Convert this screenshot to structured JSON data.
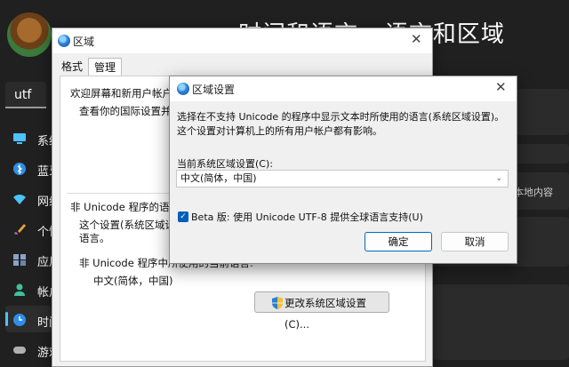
{
  "settings": {
    "search_value": "utf",
    "header_title": "时间和语言 › 语言和区域",
    "side_text": "本地内容",
    "nav": [
      {
        "label": "系统",
        "icon": "monitor-icon"
      },
      {
        "label": "蓝牙和其他设备",
        "icon": "bluetooth-icon"
      },
      {
        "label": "网络和 Internet",
        "icon": "wifi-icon"
      },
      {
        "label": "个性化",
        "icon": "brush-icon"
      },
      {
        "label": "应用",
        "icon": "apps-icon"
      },
      {
        "label": "帐户",
        "icon": "account-icon"
      },
      {
        "label": "时间和语言",
        "icon": "clock-globe-icon"
      },
      {
        "label": "游戏",
        "icon": "gamepad-icon"
      }
    ],
    "accent": "#4cc2ff"
  },
  "region_dialog": {
    "title": "区域",
    "tabs": [
      {
        "label": "格式"
      },
      {
        "label": "管理"
      }
    ],
    "welcome_heading": "欢迎屏幕和新用户帐户",
    "welcome_desc": "查看你的国际设置并将",
    "unicode_heading": "非 Unicode 程序的语言",
    "unicode_desc_1": "这个设置(系统区域设置",
    "unicode_desc_2": "语言。",
    "current_label": "非 Unicode 程序中所使用的当前语言:",
    "current_value": "中文(简体，中国)",
    "change_button": "更改系统区域设置(C)..."
  },
  "region_settings_dialog": {
    "title": "区域设置",
    "description": "选择在不支持 Unicode 的程序中显示文本时所使用的语言(系统区域设置)。这个设置对计算机上的所有用户帐户都有影响。",
    "current_locale_label": "当前系统区域设置(C):",
    "current_locale_value": "中文(简体，中国)",
    "beta_checkbox_label": "Beta 版: 使用 Unicode UTF-8 提供全球语言支持(U)",
    "beta_checked": true,
    "ok_button": "确定",
    "cancel_button": "取消",
    "accent": "#005fb8"
  }
}
